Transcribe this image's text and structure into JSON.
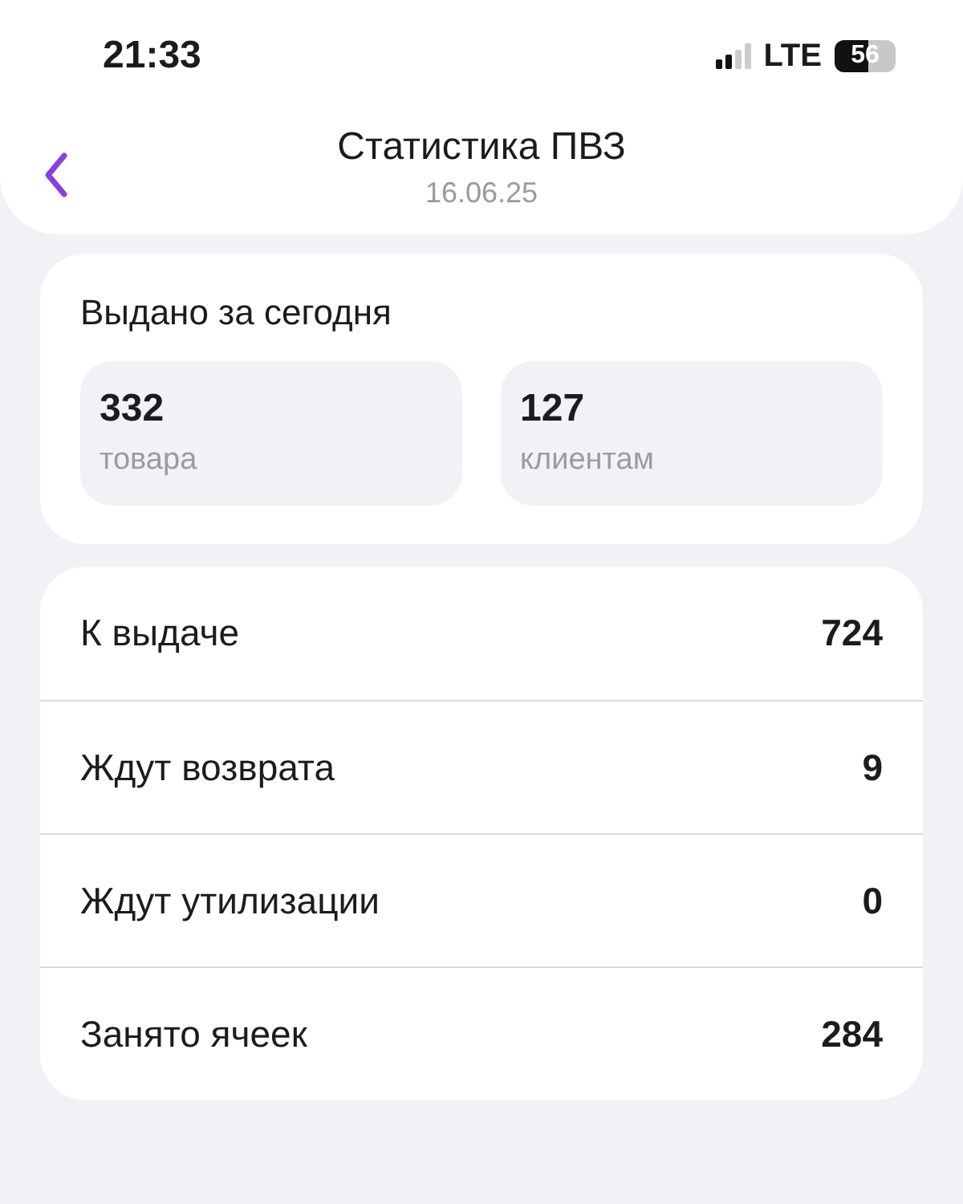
{
  "status_bar": {
    "time": "21:33",
    "network": "LTE",
    "battery": "56"
  },
  "header": {
    "title": "Статистика ПВЗ",
    "subtitle": "16.06.25"
  },
  "today": {
    "title": "Выдано за сегодня",
    "tiles": [
      {
        "value": "332",
        "label": "товара"
      },
      {
        "value": "127",
        "label": "клиентам"
      }
    ]
  },
  "stats": [
    {
      "label": "К выдаче",
      "value": "724"
    },
    {
      "label": "Ждут возврата",
      "value": "9"
    },
    {
      "label": "Ждут утилизации",
      "value": "0"
    },
    {
      "label": "Занято ячеек",
      "value": "284"
    }
  ]
}
